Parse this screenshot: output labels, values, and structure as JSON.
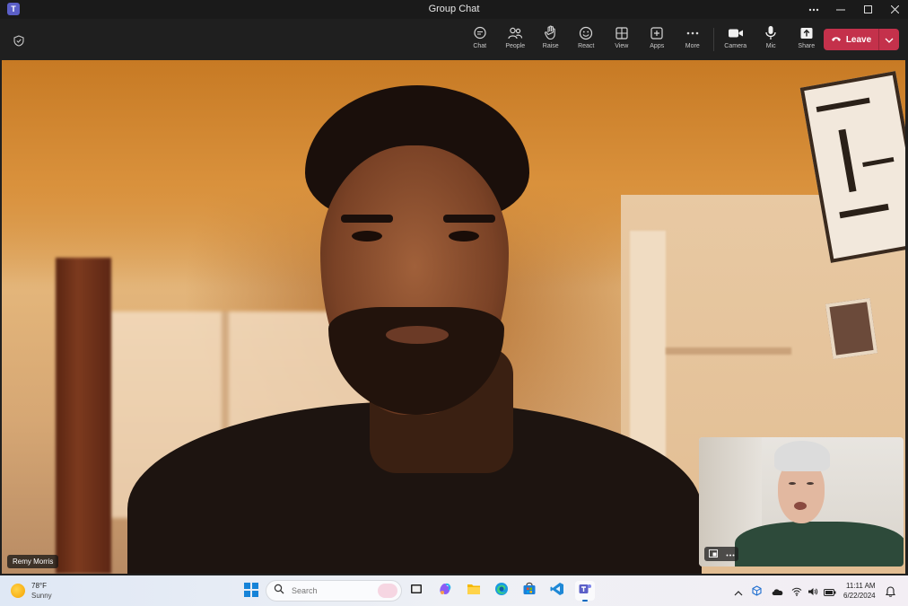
{
  "window": {
    "title": "Group Chat",
    "app_icon": "T"
  },
  "toolbar": {
    "items": [
      {
        "label": "Chat",
        "icon": "chat-icon"
      },
      {
        "label": "People",
        "icon": "people-icon"
      },
      {
        "label": "Raise",
        "icon": "raise-hand-icon"
      },
      {
        "label": "React",
        "icon": "react-icon"
      },
      {
        "label": "View",
        "icon": "view-icon"
      },
      {
        "label": "Apps",
        "icon": "apps-icon"
      },
      {
        "label": "More",
        "icon": "more-icon"
      }
    ],
    "media": [
      {
        "label": "Camera",
        "icon": "camera-icon"
      },
      {
        "label": "Mic",
        "icon": "mic-icon"
      },
      {
        "label": "Share",
        "icon": "share-icon"
      }
    ],
    "leave_label": "Leave",
    "leave_color": "#c4314b"
  },
  "stage": {
    "participant_name": "Remy Morris"
  },
  "taskbar": {
    "weather": {
      "temp": "78°F",
      "condition": "Sunny"
    },
    "search_placeholder": "Search",
    "clock": {
      "time": "11:11 AM",
      "date": "6/22/2024"
    },
    "apps": [
      "task-view",
      "copilot",
      "file-explorer",
      "edge",
      "store",
      "vs-code",
      "teams"
    ]
  }
}
